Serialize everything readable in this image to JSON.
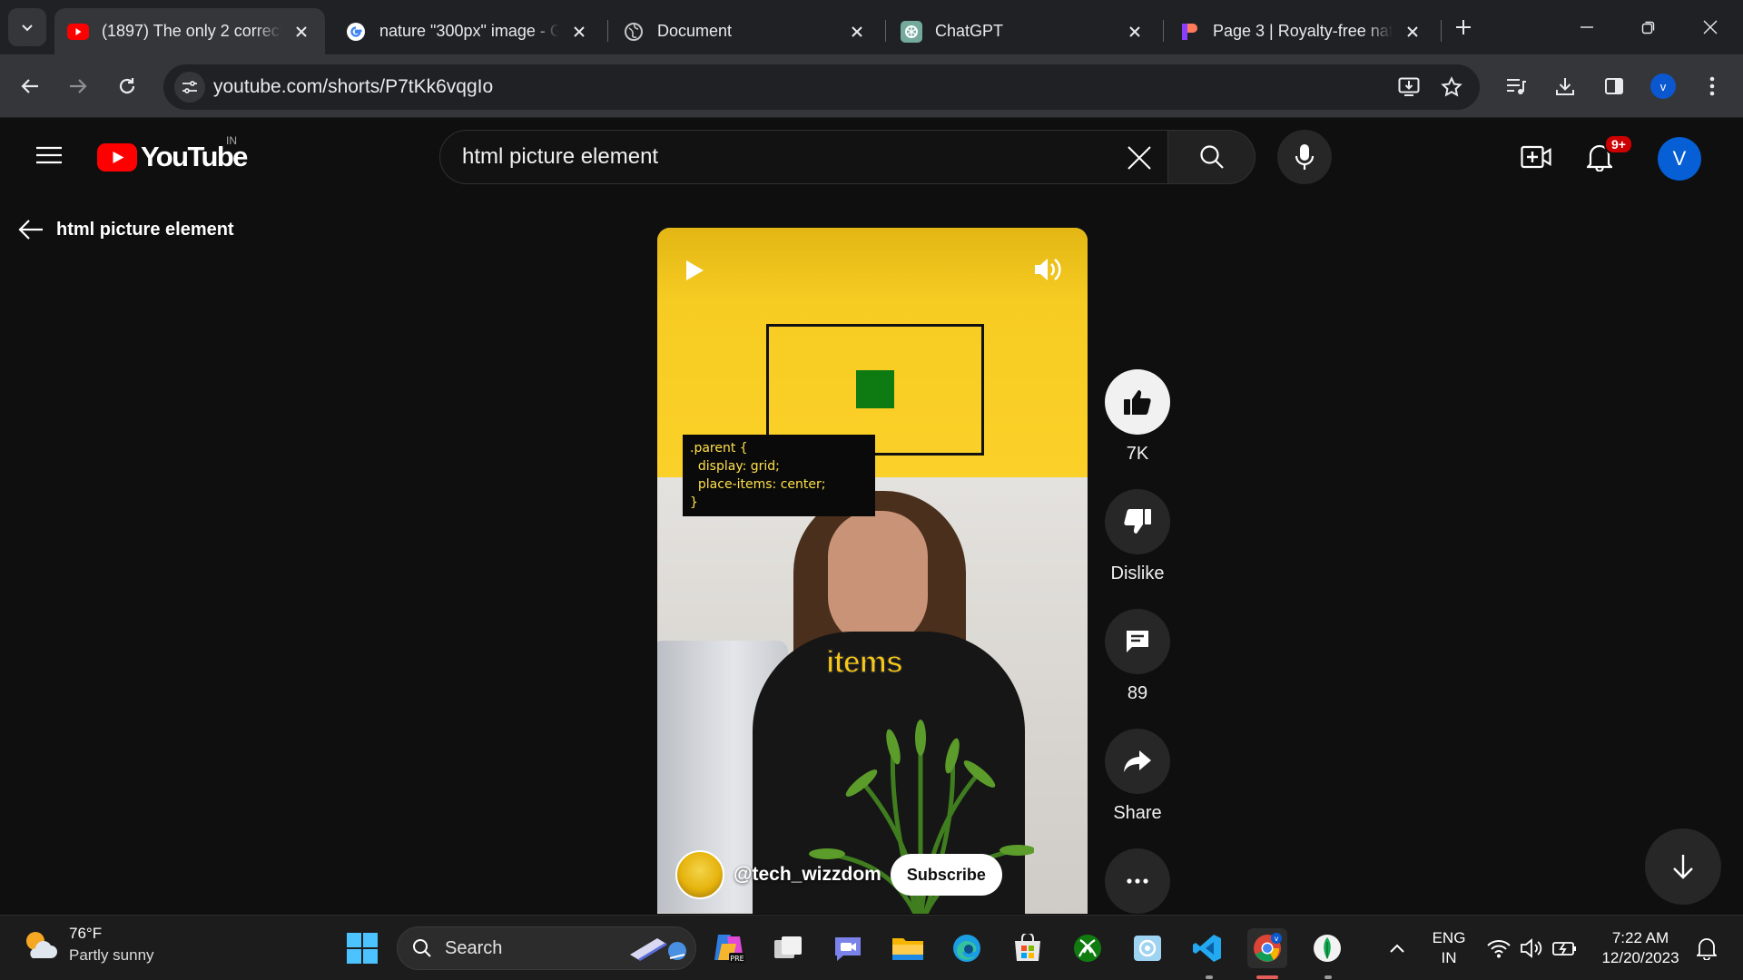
{
  "browser": {
    "tabs": [
      {
        "title": "(1897) The only 2 correct",
        "favicon": "youtube-icon",
        "active": true
      },
      {
        "title": "nature \"300px\" image - G",
        "favicon": "google-icon",
        "active": false
      },
      {
        "title": "Document",
        "favicon": "globe-icon",
        "active": false
      },
      {
        "title": "ChatGPT",
        "favicon": "chatgpt-icon",
        "active": false
      },
      {
        "title": "Page 3 | Royalty-free natu",
        "favicon": "canva-icon",
        "active": false
      }
    ],
    "url": "youtube.com/shorts/P7tKk6vqgIo",
    "profile_initial": "v"
  },
  "youtube": {
    "logo_text": "YouTube",
    "country_code": "IN",
    "search_value": "html picture element",
    "notification_badge": "9+",
    "avatar_initial": "V",
    "back_label": "html picture element"
  },
  "short": {
    "code_overlay": ".parent {\n  display: grid;\n  place-items: center;\n}",
    "caption": "items",
    "channel_handle": "@tech_wizzdom",
    "subscribe_label": "Subscribe"
  },
  "actions": {
    "like_count": "7K",
    "dislike_label": "Dislike",
    "comment_count": "89",
    "share_label": "Share"
  },
  "taskbar": {
    "temperature": "76°F",
    "weather": "Partly sunny",
    "search_label": "Search",
    "language_line1": "ENG",
    "language_line2": "IN",
    "time": "7:22 AM",
    "date": "12/20/2023"
  },
  "colors": {
    "page_bg": "#0f0f0f",
    "youtube_red": "#ff0000",
    "accent_blue": "#065fd4",
    "short_yellow": "#fbd028"
  }
}
